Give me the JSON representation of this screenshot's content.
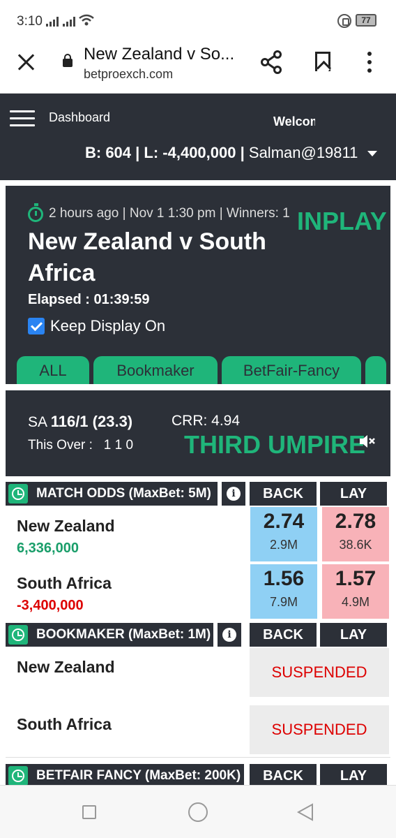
{
  "status_bar": {
    "time": "3:10",
    "battery": "77"
  },
  "browser": {
    "title": "New Zealand v So...",
    "url": "betproexch.com"
  },
  "header": {
    "dashboard_label": "Dashboard",
    "welcome": "Welcome",
    "balance": "B: 604 | L: -4,400,000 |",
    "username": "Salman@19811"
  },
  "event": {
    "meta": "2 hours ago | Nov 1 1:30 pm | Winners: 1",
    "status": "INPLAY",
    "name": "New Zealand v South Africa",
    "elapsed": "Elapsed : 01:39:59",
    "keep_display": "Keep Display On",
    "tabs": [
      "ALL",
      "Bookmaker",
      "BetFair-Fancy"
    ]
  },
  "score": {
    "team": "SA",
    "runs": "116/1 (23.3)",
    "crr": "CRR: 4.94",
    "this_over_label": "This Over :",
    "this_over": "1 1 0",
    "decision": "THIRD UMPIRE"
  },
  "match_odds": {
    "title": "MATCH ODDS (MaxBet: 5M)",
    "back_label": "BACK",
    "lay_label": "LAY",
    "runners": [
      {
        "name": "New Zealand",
        "pl": "6,336,000",
        "back": "2.74",
        "back_size": "2.9M",
        "lay": "2.78",
        "lay_size": "38.6K"
      },
      {
        "name": "South Africa",
        "pl": "-3,400,000",
        "back": "1.56",
        "back_size": "7.9M",
        "lay": "1.57",
        "lay_size": "4.9M"
      }
    ]
  },
  "bookmaker": {
    "title": "BOOKMAKER (MaxBet: 1M)",
    "back_label": "BACK",
    "lay_label": "LAY",
    "runners": [
      {
        "name": "New Zealand",
        "status": "SUSPENDED"
      },
      {
        "name": "South Africa",
        "status": "SUSPENDED"
      }
    ]
  },
  "betfair_fancy": {
    "title": "BETFAIR FANCY (MaxBet: 200K)",
    "back_label": "BACK",
    "lay_label": "LAY"
  },
  "colors": {
    "dark": "#2c3038",
    "accent_green": "#1fb57a",
    "back_blue": "#8fd0f4",
    "lay_pink": "#f8b2b8",
    "loss_red": "#dd0000"
  }
}
